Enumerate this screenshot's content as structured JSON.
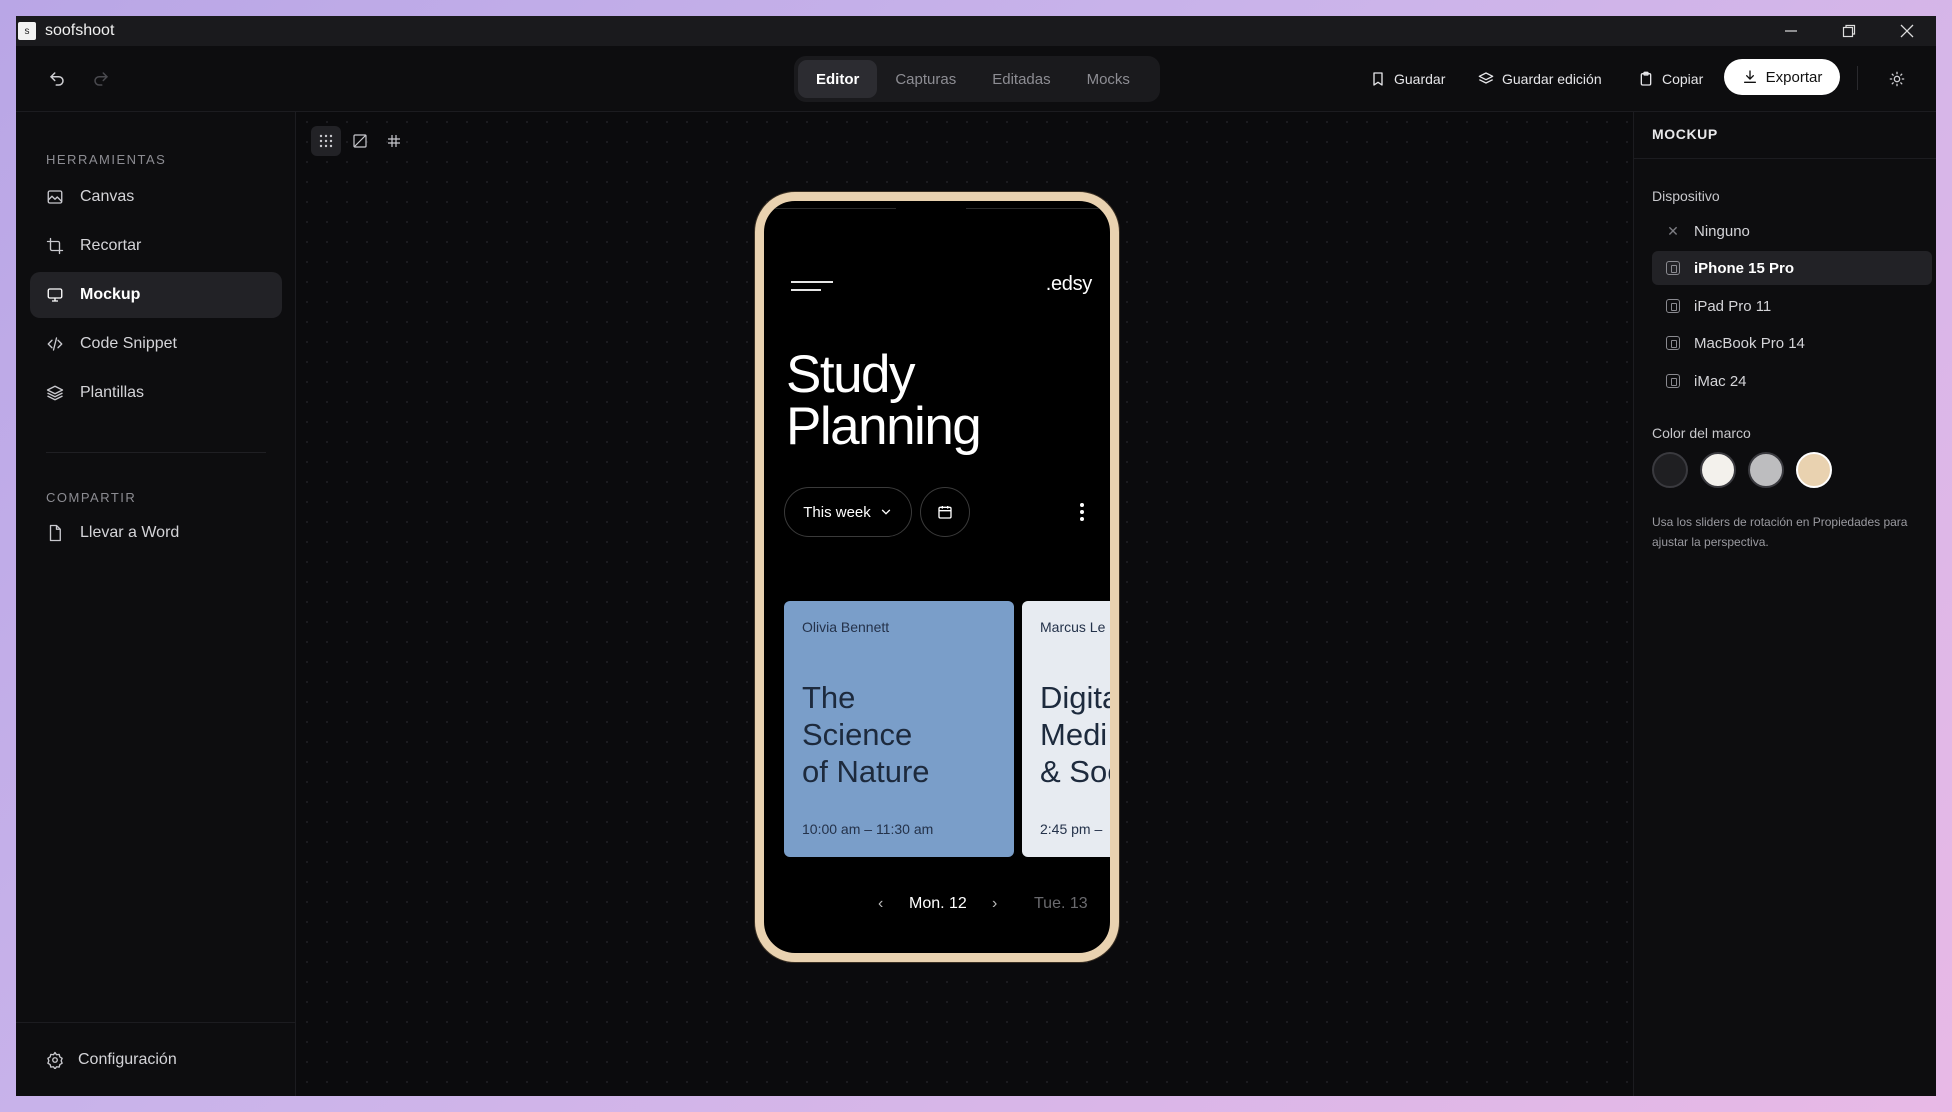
{
  "app": {
    "title": "soofshoot",
    "icon_glyph": "s"
  },
  "window_controls": {
    "minimize": "minimize-icon",
    "maximize": "restore-icon",
    "close": "close-icon"
  },
  "toolbar": {
    "undo_icon": "undo-icon",
    "redo_icon": "redo-icon",
    "tabs": [
      {
        "label": "Editor",
        "active": true
      },
      {
        "label": "Capturas",
        "active": false
      },
      {
        "label": "Editadas",
        "active": false
      },
      {
        "label": "Mocks",
        "active": false
      }
    ],
    "save_label": "Guardar",
    "save_edit_label": "Guardar edición",
    "copy_label": "Copiar",
    "export_label": "Exportar",
    "theme_icon": "sun-icon"
  },
  "sidebar": {
    "tools_heading": "HERRAMIENTAS",
    "tools": [
      {
        "label": "Canvas",
        "icon": "image-icon",
        "active": false
      },
      {
        "label": "Recortar",
        "icon": "crop-icon",
        "active": false
      },
      {
        "label": "Mockup",
        "icon": "monitor-icon",
        "active": true
      },
      {
        "label": "Code Snippet",
        "icon": "code-icon",
        "active": false
      },
      {
        "label": "Plantillas",
        "icon": "layers-icon",
        "active": false
      }
    ],
    "share_heading": "COMPARTIR",
    "share": [
      {
        "label": "Llevar a Word",
        "icon": "file-icon"
      }
    ],
    "settings_label": "Configuración"
  },
  "canvas": {
    "view_modes": [
      "dots-grid-icon",
      "no-grid-icon",
      "lines-grid-icon"
    ],
    "active_view": 0,
    "mockup": {
      "brand": ".edsy",
      "title_line1": "Study",
      "title_line2": "Planning",
      "week_selector": "This week",
      "cards": [
        {
          "person": "Olivia Bennett",
          "title_lines": [
            "The",
            "Science",
            "of Nature"
          ],
          "time": "10:00 am – 11:30 am",
          "color": "#7a9ec9"
        },
        {
          "person": "Marcus Le",
          "title_lines": [
            "Digita",
            "Medi",
            "& Soc"
          ],
          "time": "2:45 pm –",
          "color": "#e7ebf1"
        }
      ],
      "date_current": "Mon. 12",
      "date_next": "Tue. 13"
    }
  },
  "panel": {
    "title": "MOCKUP",
    "device_label": "Dispositivo",
    "devices": [
      {
        "label": "Ninguno",
        "icon": "x-icon",
        "active": false
      },
      {
        "label": "iPhone 15 Pro",
        "icon": "phone-icon",
        "active": true
      },
      {
        "label": "iPad Pro 11",
        "icon": "tablet-icon",
        "active": false
      },
      {
        "label": "MacBook Pro 14",
        "icon": "laptop-icon",
        "active": false
      },
      {
        "label": "iMac 24",
        "icon": "desktop-icon",
        "active": false
      }
    ],
    "frame_color_label": "Color del marco",
    "frame_colors": [
      "#1f1f22",
      "#f3f1ec",
      "#bdbdbf",
      "#e9d2b0"
    ],
    "selected_frame_color": "#e9d2b0",
    "hint": "Usa los sliders de rotación en Propiedades para ajustar la perspectiva."
  }
}
